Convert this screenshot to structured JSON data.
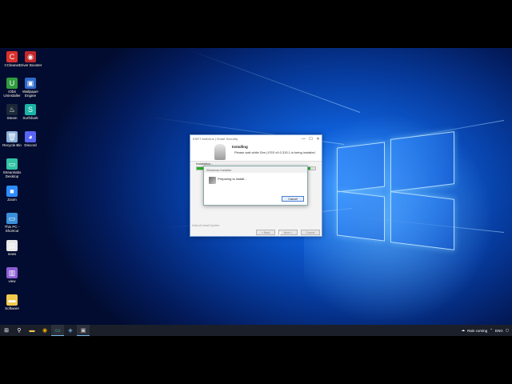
{
  "desktop_icons": [
    {
      "label": "CCleaner",
      "color": "#d9322b",
      "glyph": "C"
    },
    {
      "label": "Driver Booster",
      "color": "#c0272d",
      "glyph": "◉"
    },
    {
      "label": "IObit Uninstaller",
      "color": "#2f9b3e",
      "glyph": "U"
    },
    {
      "label": "Wallpaper Engine",
      "color": "#2e6ac9",
      "glyph": "▣"
    },
    {
      "label": "Steam",
      "color": "#1b2838",
      "glyph": "♨"
    },
    {
      "label": "Surfshark",
      "color": "#1ab3a6",
      "glyph": "S"
    },
    {
      "label": "Recycle Bin",
      "color": "#8ab0d8",
      "glyph": "🗑"
    },
    {
      "label": "Discord",
      "color": "#5865f2",
      "glyph": "◕"
    },
    {
      "label": "Streamlabs Desktop",
      "color": "#31c3a2",
      "glyph": "▭"
    },
    {
      "label": "Zoom",
      "color": "#2d8cff",
      "glyph": "■"
    },
    {
      "label": "This PC - Shortcut",
      "color": "#3a8fd9",
      "glyph": "▭"
    },
    {
      "label": "news",
      "color": "#e8e8e8",
      "glyph": "▤"
    },
    {
      "label": "view",
      "color": "#8e5ed6",
      "glyph": "▥"
    },
    {
      "label": "Software",
      "color": "#f2c94c",
      "glyph": "▬"
    }
  ],
  "installer": {
    "window_title": "ESET Antivirus | Smart Security",
    "heading": "Installing",
    "subheading": "Please wait while Dim | ESS v9.0.315.1 is being installed.",
    "progress_label": "Installation...",
    "progress_pct": 96,
    "footer": "Nullsoft Install System",
    "back_label": "< Back",
    "next_label": "Next >",
    "cancel_label": "Cancel",
    "controls": [
      "—",
      "☐",
      "✕"
    ]
  },
  "popup": {
    "title": "Windows Installer",
    "message": "Preparing to install...",
    "cancel_label": "Cancel"
  },
  "taskbar": {
    "weather": "Rain coming",
    "language": "ENG"
  }
}
